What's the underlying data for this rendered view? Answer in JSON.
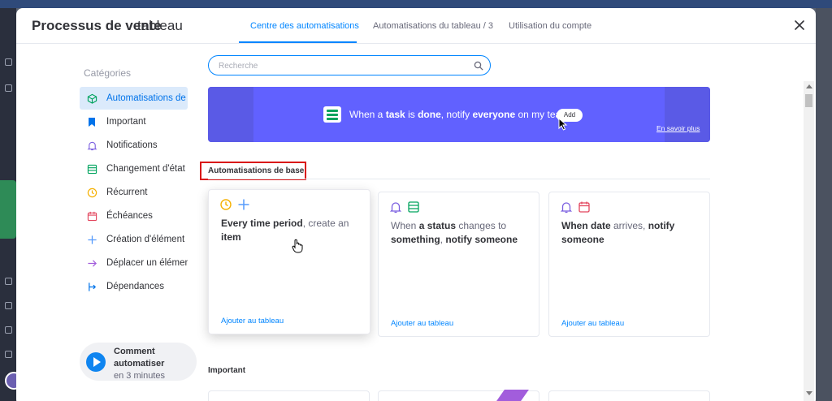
{
  "modal": {
    "title": "Processus de vente",
    "subtitle": "tableau",
    "tabs": [
      {
        "label": "Centre des automatisations",
        "active": true
      },
      {
        "label": "Automatisations du tableau  / 3",
        "active": false
      },
      {
        "label": "Utilisation du compte",
        "active": false
      }
    ],
    "close_icon": "close-icon"
  },
  "sidebar": {
    "title": "Catégories",
    "items": [
      {
        "label": "Automatisations de",
        "icon": "cube-icon",
        "active": true
      },
      {
        "label": "Important",
        "icon": "bookmark-icon"
      },
      {
        "label": "Notifications",
        "icon": "bell-icon"
      },
      {
        "label": "Changement d'état",
        "icon": "status-list-icon"
      },
      {
        "label": "Récurrent",
        "icon": "clock-icon"
      },
      {
        "label": "Échéances",
        "icon": "calendar-icon"
      },
      {
        "label": "Création d'élément",
        "icon": "plus-icon"
      },
      {
        "label": "Déplacer un élémen",
        "icon": "arrow-right-icon"
      },
      {
        "label": "Dépendances",
        "icon": "dependency-icon"
      }
    ],
    "howto": {
      "title": "Comment automatiser",
      "subtitle": "en 3 minutes"
    }
  },
  "search": {
    "placeholder": "Recherche",
    "value": ""
  },
  "banner": {
    "text_parts": [
      "When a ",
      "task",
      " is ",
      "done",
      ", notify ",
      "everyone",
      " on my team"
    ],
    "add_label": "Add",
    "learn_more": "En savoir plus"
  },
  "sections": {
    "basic_title": "Automatisations de base",
    "important_title": "Important"
  },
  "cards": [
    {
      "icons": [
        "clock-icon",
        "plus-icon"
      ],
      "parts": [
        {
          "t": "Every time period",
          "s": "b"
        },
        {
          "t": ", create an ",
          "s": "l"
        },
        {
          "t": "item",
          "s": "b"
        }
      ],
      "link": "Ajouter au tableau"
    },
    {
      "icons": [
        "bell-icon",
        "status-list-icon"
      ],
      "parts": [
        {
          "t": "When ",
          "s": "l"
        },
        {
          "t": "a status",
          "s": "b"
        },
        {
          "t": " changes to ",
          "s": "l"
        },
        {
          "t": "something",
          "s": "b"
        },
        {
          "t": ", ",
          "s": "l"
        },
        {
          "t": "notify someone",
          "s": "b"
        }
      ],
      "link": "Ajouter au tableau"
    },
    {
      "icons": [
        "bell-icon",
        "calendar-icon"
      ],
      "parts": [
        {
          "t": "When  date",
          "s": "b"
        },
        {
          "t": " arrives, ",
          "s": "l"
        },
        {
          "t": "notify someone",
          "s": "b"
        }
      ],
      "link": "Ajouter au tableau"
    }
  ],
  "colors": {
    "accent": "#0085ff",
    "banner": "#6161ff",
    "highlight_box": "#d91818",
    "sidebar_active_bg": "#dbeafb"
  }
}
